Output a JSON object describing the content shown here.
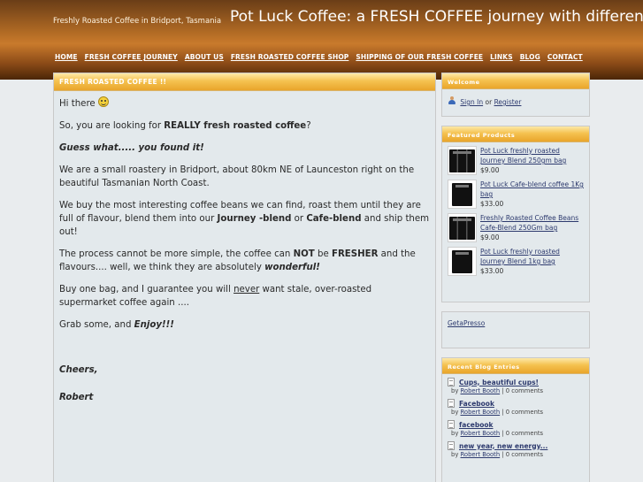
{
  "header": {
    "tagline": "Freshly Roasted Coffee in Bridport, Tasmania",
    "title": "Pot Luck Coffee: a FRESH COFFEE journey with differenc",
    "nav": [
      "HOME",
      "FRESH COFFEE JOURNEY",
      "ABOUT US",
      "FRESH ROASTED COFFEE SHOP",
      "SHIPPING OF OUR FRESH COFFEE",
      "LINKS",
      "BLOG",
      "CONTACT"
    ]
  },
  "main": {
    "heading": "FRESH ROASTED COFFEE !!",
    "p1": "Hi there",
    "p2_pre": "So, you are looking for ",
    "p2_bold": "REALLY fresh roasted coffee",
    "p2_post": "?",
    "p3": "Guess what..... you found it!",
    "p4": "We are a small roastery in Bridport,  about 80km NE of Launceston right on the beautiful Tasmanian North Coast.",
    "p5_a": "We buy the most interesting coffee beans we can find, roast them until they are full of flavour, blend them into our ",
    "p5_b": "Journey -blend",
    "p5_c": " or ",
    "p5_d": "Cafe-blend",
    "p5_e": " and ship them out!",
    "p6_a": "The process cannot be more simple, the coffee can ",
    "p6_b": "NOT",
    "p6_c": " be ",
    "p6_d": "FRESHER",
    "p6_e": " and the flavours.... well, we think they are absolutely ",
    "p6_f": "wonderful!",
    "p7_a": "Buy one bag, and I guarantee you will ",
    "p7_b": "never",
    "p7_c": " want stale, over-roasted supermarket coffee again ....",
    "p8_a": "Grab some, and ",
    "p8_b": "Enjoy!!!",
    "p9": "Cheers,",
    "p10": "Robert"
  },
  "welcome": {
    "heading": "Welcome",
    "signin": "Sign In",
    "or": " or ",
    "register": "Register"
  },
  "featured": {
    "heading": "Featured Products",
    "products": [
      {
        "name": "Pot Luck freshly roasted Journey Blend 250gm bag",
        "price": "$9.00"
      },
      {
        "name": "Pot Luck Cafe-blend coffee 1Kg bag",
        "price": "$33.00"
      },
      {
        "name": "Freshly Roasted Coffee Beans Cafe-Blend 250Gm bag",
        "price": "$9.00"
      },
      {
        "name": "Pot Luck freshly roasted Journey Blend 1kg bag",
        "price": "$33.00"
      }
    ]
  },
  "getapresso": {
    "link": "GetaPresso"
  },
  "blog": {
    "heading": "Recent Blog Entries",
    "entries": [
      {
        "title": "Cups, beautiful cups!",
        "by": "by ",
        "author": "Robert Booth",
        "comments": " | 0 comments"
      },
      {
        "title": "Facebook",
        "by": "by ",
        "author": "Robert Booth",
        "comments": " | 0 comments"
      },
      {
        "title": "facebook",
        "by": "by ",
        "author": "Robert Booth",
        "comments": " | 0 comments"
      },
      {
        "title": "new year, new energy...",
        "by": "by ",
        "author": "Robert Booth",
        "comments": " | 0 comments"
      }
    ]
  }
}
